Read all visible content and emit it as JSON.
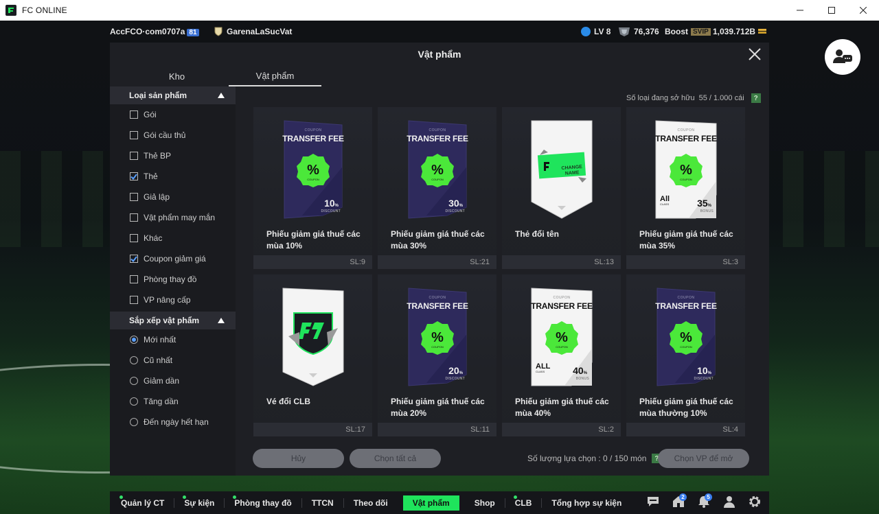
{
  "window": {
    "title": "FC ONLINE"
  },
  "topbar": {
    "account": "AccFCO·com0707a",
    "account_badge": "81",
    "club": "GarenaLaSucVat",
    "level": "LV 8",
    "coins": "76,376",
    "boost_label": "Boost",
    "svip": "SVIP",
    "bp": "1,039.712B"
  },
  "modal": {
    "title": "Vật phẩm",
    "tabs": [
      "Kho",
      "Vật phẩm"
    ],
    "owned_label": "Số loại đang sở hữu",
    "owned_value": "55 / 1.000 cái",
    "help": "?"
  },
  "sidebar": {
    "product_header": "Loại sản phẩm",
    "product_types": [
      {
        "label": "Gói",
        "checked": false
      },
      {
        "label": "Gói cầu thủ",
        "checked": false
      },
      {
        "label": "Thẻ BP",
        "checked": false
      },
      {
        "label": "Thẻ",
        "checked": true
      },
      {
        "label": "Giả lập",
        "checked": false
      },
      {
        "label": "Vật phẩm may mắn",
        "checked": false
      },
      {
        "label": "Khác",
        "checked": false
      },
      {
        "label": "Coupon giảm giá",
        "checked": true
      },
      {
        "label": "Phòng thay đồ",
        "checked": false
      },
      {
        "label": "VP nâng cấp",
        "checked": false
      }
    ],
    "sort_header": "Sắp xếp vật phẩm",
    "sort_options": [
      {
        "label": "Mới nhất",
        "selected": true
      },
      {
        "label": "Cũ nhất",
        "selected": false
      },
      {
        "label": "Giảm dần",
        "selected": false
      },
      {
        "label": "Tăng dần",
        "selected": false
      },
      {
        "label": "Đến ngày hết hạn",
        "selected": false
      }
    ]
  },
  "items": [
    {
      "name": "Phiếu giảm giá thuế các mùa 10%",
      "qty": "SL:9",
      "kind": "coupon-dark",
      "coupon": "COUPON",
      "fee": "TRANSFER FEE",
      "pct": "10",
      "tag": "DISCOUNT"
    },
    {
      "name": "Phiếu giảm giá thuế các mùa 30%",
      "qty": "SL:21",
      "kind": "coupon-dark",
      "coupon": "COUPON",
      "fee": "TRANSFER FEE",
      "pct": "30",
      "tag": "DISCOUNT"
    },
    {
      "name": "Thẻ đổi tên",
      "qty": "SL:13",
      "kind": "rename",
      "ticket": "CHANGE NAME"
    },
    {
      "name": "Phiếu giảm giá thuế các mùa 35%",
      "qty": "SL:3",
      "kind": "coupon-white",
      "coupon": "COUPON",
      "fee": "TRANSFER FEE",
      "pct": "35",
      "tag": "BONUS",
      "cls": "All",
      "cls_sub": "CLASS"
    },
    {
      "name": "Vé đổi CLB",
      "qty": "SL:17",
      "kind": "club"
    },
    {
      "name": "Phiếu giảm giá thuế các mùa 20%",
      "qty": "SL:11",
      "kind": "coupon-dark",
      "coupon": "COUPON",
      "fee": "TRANSFER FEE",
      "pct": "20",
      "tag": "DISCOUNT"
    },
    {
      "name": "Phiếu giảm giá thuế các mùa 40%",
      "qty": "SL:2",
      "kind": "coupon-white",
      "coupon": "COUPON",
      "fee": "TRANSFER FEE",
      "pct": "40",
      "tag": "BONUS",
      "cls": "ALL",
      "cls_sub": "CLASS"
    },
    {
      "name": "Phiếu giảm giá thuế các mùa thường 10%",
      "qty": "SL:4",
      "kind": "coupon-dark",
      "coupon": "COUPON",
      "fee": "TRANSFER FEE",
      "pct": "10",
      "tag": "DISCOUNT"
    }
  ],
  "footer": {
    "cancel": "Hủy",
    "select_all": "Chọn tất cả",
    "selection_label": "Số lượng lựa chọn : 0 / 150 món",
    "open": "Chọn VP để mở"
  },
  "bottomnav": [
    {
      "label": "Quản lý CT",
      "dot": true,
      "active": false
    },
    {
      "label": "Sự kiện",
      "dot": true,
      "active": false
    },
    {
      "label": "Phòng thay đồ",
      "dot": true,
      "active": false
    },
    {
      "label": "TTCN",
      "dot": false,
      "active": false
    },
    {
      "label": "Theo dõi",
      "dot": false,
      "active": false
    },
    {
      "label": "Vật phẩm",
      "dot": false,
      "active": true
    },
    {
      "label": "Shop",
      "dot": false,
      "active": false
    },
    {
      "label": "CLB",
      "dot": true,
      "active": false
    },
    {
      "label": "Tổng hợp sự kiện",
      "dot": false,
      "active": false
    }
  ],
  "nav_icons": [
    {
      "name": "chat-icon",
      "badge": ""
    },
    {
      "name": "home-icon",
      "badge": "2"
    },
    {
      "name": "bell-icon",
      "badge": "5"
    },
    {
      "name": "person-icon",
      "badge": ""
    },
    {
      "name": "gear-icon",
      "badge": ""
    }
  ],
  "colors": {
    "accent": "#1fe45c",
    "coupon_green": "#4be83a",
    "coupon_dark": "#2a2750",
    "checkbox_blue": "#5aa0ff"
  }
}
